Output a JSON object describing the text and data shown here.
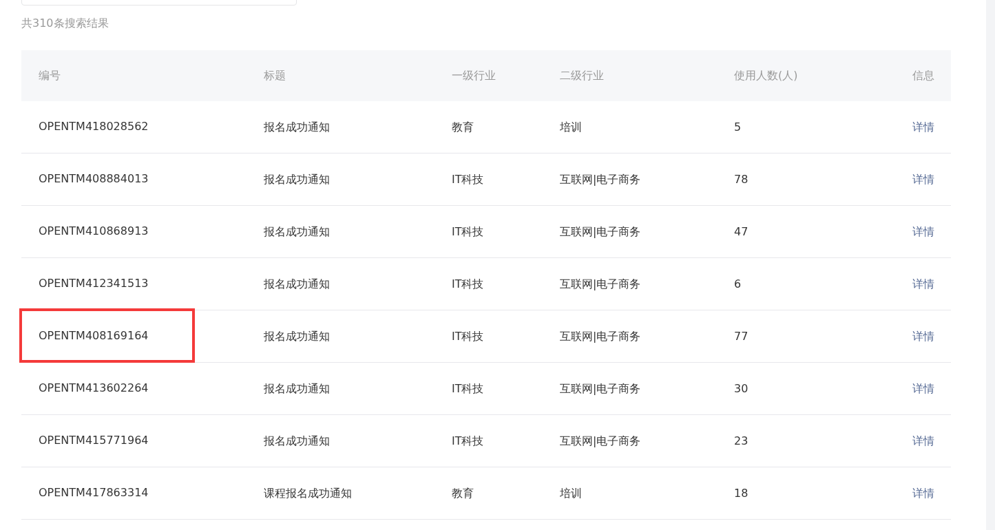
{
  "result_count": "共310条搜索结果",
  "table": {
    "columns": [
      "编号",
      "标题",
      "一级行业",
      "二级行业",
      "使用人数(人)",
      "信息"
    ],
    "rows": [
      {
        "id": "OPENTM418028562",
        "title": "报名成功通知",
        "industry_1": "教育",
        "industry_2": "培训",
        "users": "5",
        "info": "详情",
        "highlighted": false
      },
      {
        "id": "OPENTM408884013",
        "title": "报名成功通知",
        "industry_1": "IT科技",
        "industry_2": "互联网|电子商务",
        "users": "78",
        "info": "详情",
        "highlighted": false
      },
      {
        "id": "OPENTM410868913",
        "title": "报名成功通知",
        "industry_1": "IT科技",
        "industry_2": "互联网|电子商务",
        "users": "47",
        "info": "详情",
        "highlighted": false
      },
      {
        "id": "OPENTM412341513",
        "title": "报名成功通知",
        "industry_1": "IT科技",
        "industry_2": "互联网|电子商务",
        "users": "6",
        "info": "详情",
        "highlighted": false
      },
      {
        "id": "OPENTM408169164",
        "title": "报名成功通知",
        "industry_1": "IT科技",
        "industry_2": "互联网|电子商务",
        "users": "77",
        "info": "详情",
        "highlighted": true
      },
      {
        "id": "OPENTM413602264",
        "title": "报名成功通知",
        "industry_1": "IT科技",
        "industry_2": "互联网|电子商务",
        "users": "30",
        "info": "详情",
        "highlighted": false
      },
      {
        "id": "OPENTM415771964",
        "title": "报名成功通知",
        "industry_1": "IT科技",
        "industry_2": "互联网|电子商务",
        "users": "23",
        "info": "详情",
        "highlighted": false
      },
      {
        "id": "OPENTM417863314",
        "title": "课程报名成功通知",
        "industry_1": "教育",
        "industry_2": "培训",
        "users": "18",
        "info": "详情",
        "highlighted": false
      }
    ]
  }
}
